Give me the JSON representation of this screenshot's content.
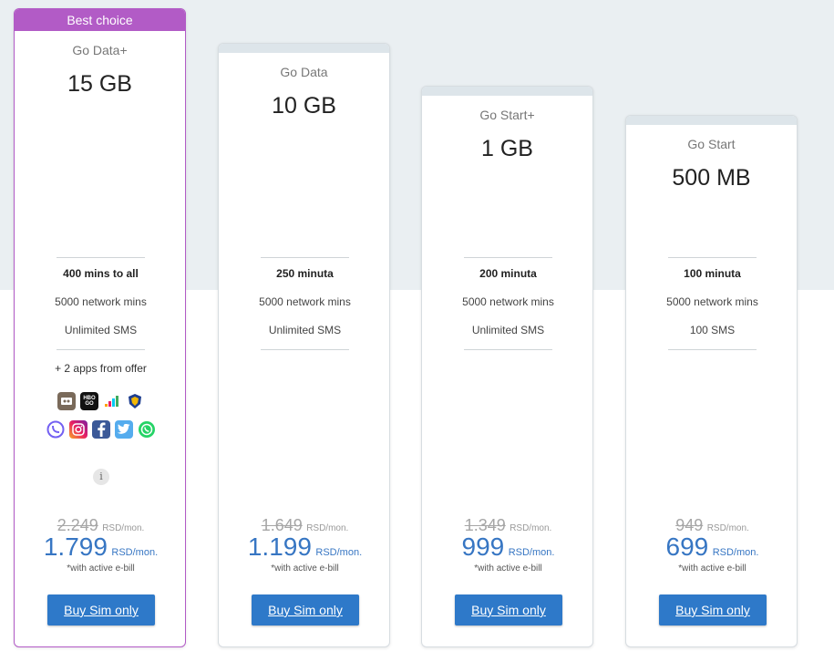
{
  "badge": "Best choice",
  "cards": [
    {
      "name": "Go Data+",
      "data": "15 GB",
      "features": [
        "400 mins to all",
        "5000 network mins",
        "Unlimited SMS"
      ],
      "apps_label": "+ 2 apps from offer",
      "old_price": "2.249",
      "old_unit": "RSD/mon.",
      "new_price": "1.799",
      "new_unit": "RSD/mon.",
      "note": "*with active e-bill",
      "button": "Buy Sim only"
    },
    {
      "name": "Go Data",
      "data": "10 GB",
      "features": [
        "250 minuta",
        "5000 network mins",
        "Unlimited SMS"
      ],
      "old_price": "1.649",
      "old_unit": "RSD/mon.",
      "new_price": "1.199",
      "new_unit": "RSD/mon.",
      "note": "*with active e-bill",
      "button": "Buy Sim only"
    },
    {
      "name": "Go Start+",
      "data": "1 GB",
      "features": [
        "200 minuta",
        "5000 network mins",
        "Unlimited SMS"
      ],
      "old_price": "1.349",
      "old_unit": "RSD/mon.",
      "new_price": "999",
      "new_unit": "RSD/mon.",
      "note": "*with active e-bill",
      "button": "Buy Sim only"
    },
    {
      "name": "Go Start",
      "data": "500 MB",
      "features": [
        "100 minuta",
        "5000 network mins",
        "100 SMS"
      ],
      "old_price": "949",
      "old_unit": "RSD/mon.",
      "new_price": "699",
      "new_unit": "RSD/mon.",
      "note": "*with active e-bill",
      "button": "Buy Sim only"
    }
  ],
  "apps": {
    "row1": [
      "emotion-app-icon",
      "hbo-go-app-icon",
      "deezer-app-icon",
      "sports-shield-app-icon"
    ],
    "row2": [
      "viber-icon",
      "instagram-icon",
      "facebook-icon",
      "twitter-icon",
      "whatsapp-icon"
    ],
    "logo_text": {
      "hbo": "HBO GO"
    }
  },
  "info_symbol": "i",
  "colors": {
    "accent": "#3776c3",
    "best": "#b25bc6",
    "button": "#2e79c9"
  }
}
